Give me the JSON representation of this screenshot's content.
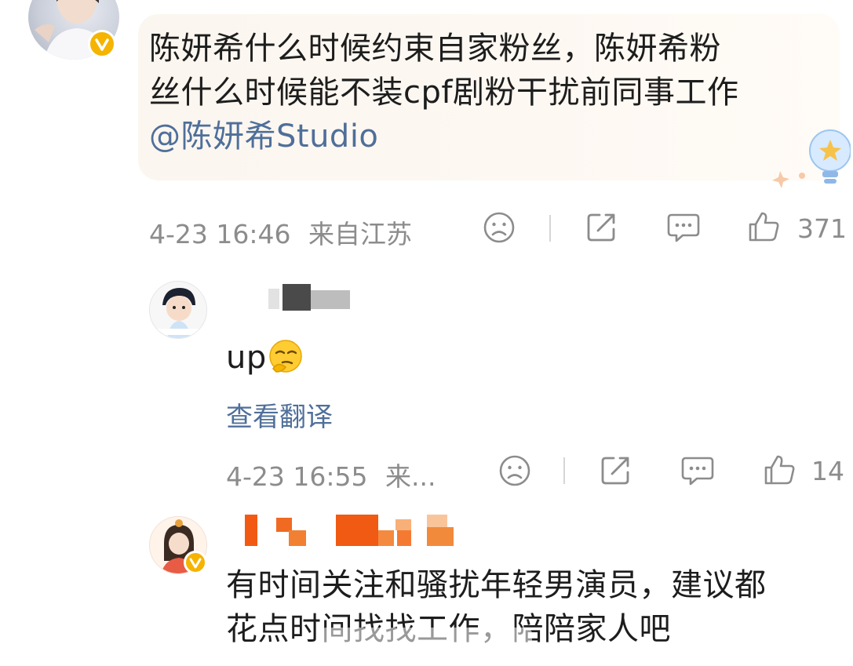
{
  "comment1": {
    "text_line1": "陈妍希什么时候约束自家粉丝，陈妍希粉",
    "text_line2": "丝什么时候能不装cpf剧粉干扰前同事工作",
    "mention": "@陈妍希Studio",
    "timestamp": "4-23 16:46",
    "location": "来自江苏",
    "like_count": "371"
  },
  "comment2": {
    "text": "up",
    "translate_label": "查看翻译",
    "timestamp": "4-23 16:55",
    "location": "来...",
    "like_count": "14"
  },
  "comment3": {
    "text_line1": "有时间关注和骚扰年轻男演员，建议都",
    "text_line2": "花点时间找找工作，陪陪家人吧"
  },
  "colors": {
    "meta_gray": "#8c8c8c",
    "mention_blue": "#4f6f9a",
    "verified_gold": "#f5b400",
    "bubble_bg": "#fbf6ef"
  },
  "icons": [
    "sad-face-icon",
    "share-icon",
    "comment-icon",
    "thumbs-up-icon",
    "verified-v-icon",
    "lightbulb-icon",
    "thinking-emoji-icon"
  ]
}
